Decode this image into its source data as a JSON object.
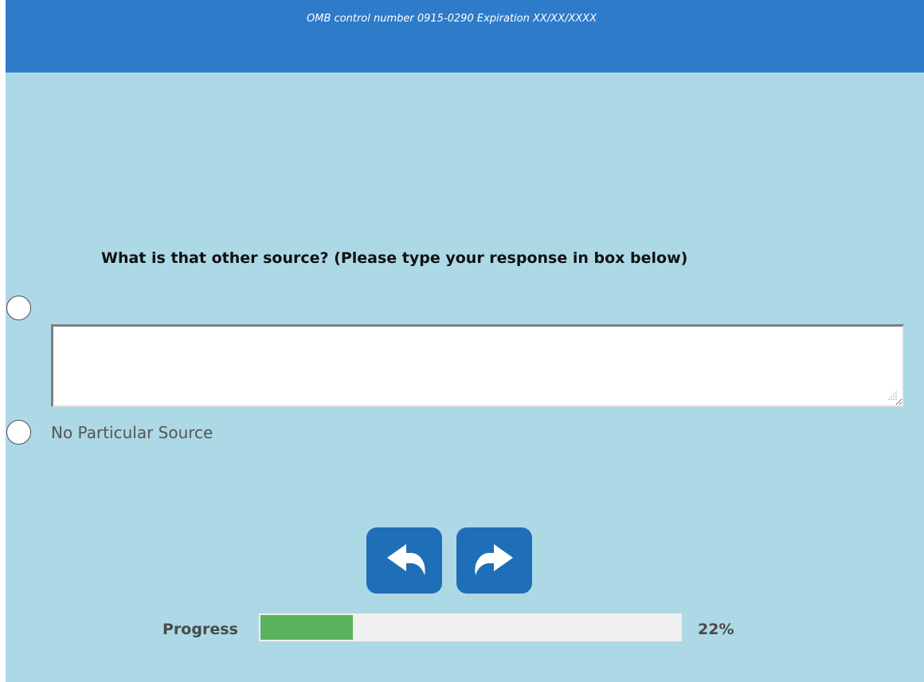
{
  "header": {
    "omb_text": "OMB control number 0915-0290 Expiration XX/XX/XXXX",
    "background_color": "#2e7bc9"
  },
  "question": {
    "text": "What is that other source? (Please type your response in box below)"
  },
  "options": [
    {
      "label": "",
      "type": "other-with-text",
      "selected": false,
      "input_value": "",
      "input_placeholder": ""
    },
    {
      "label": "No Particular Source",
      "selected": false
    }
  ],
  "navigation": {
    "back_icon": "undo-arrow-icon",
    "next_icon": "redo-arrow-icon",
    "button_color": "#1f6fb8"
  },
  "progress": {
    "label": "Progress",
    "percent": 22,
    "percent_text": "22%",
    "fill_color": "#5cb35e"
  },
  "colors": {
    "page_background": "#add8e6"
  }
}
